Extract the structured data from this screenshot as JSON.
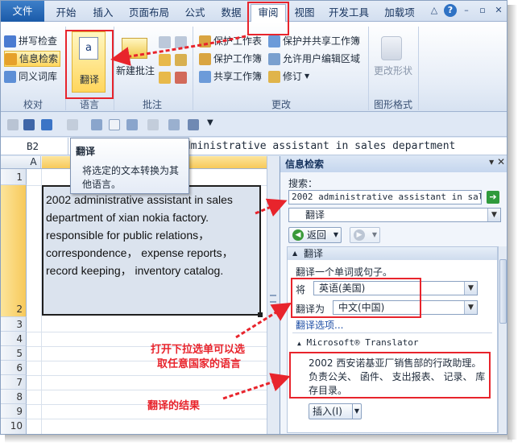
{
  "tabs": [
    "文件",
    "开始",
    "插入",
    "页面布局",
    "公式",
    "数据",
    "审阅",
    "视图",
    "开发工具",
    "加载项"
  ],
  "active_tab": "审阅",
  "window_buttons": [
    "△",
    "?",
    "–",
    "▫",
    "✕"
  ],
  "ribbon": {
    "proofing": {
      "spell": "拼写检查",
      "research": "信息检索",
      "thesaurus": "同义词库",
      "label": "校对"
    },
    "language": {
      "translate": "翻译",
      "label": "语言"
    },
    "comments": {
      "new_comment": "新建批注",
      "label": "批注"
    },
    "changes": {
      "protect_sheet": "保护工作表",
      "protect_workbook": "保护工作簿",
      "share_workbook": "共享工作簿",
      "protect_share": "保护并共享工作簿",
      "allow_edit": "允许用户编辑区域",
      "track": "修订",
      "label": "更改"
    },
    "ink": {
      "change_shape": "更改形状",
      "label": "图形格式"
    }
  },
  "formula_bar": {
    "name_box": "B2",
    "content": "administrative assistant in sales department"
  },
  "tooltip": {
    "title": "翻译",
    "body": "将选定的文本转换为其他语言。"
  },
  "sheet": {
    "col_a": "A",
    "rows": [
      "1",
      "2",
      "3",
      "4",
      "5",
      "6",
      "7",
      "8",
      "9",
      "10"
    ],
    "cell_b2_lines": [
      "2002 administrative assistant in sales",
      "department of xian nokia factory.",
      "responsible for public relations，",
      "correspondence，  expense reports，",
      "record keeping，  inventory catalog."
    ]
  },
  "pane": {
    "title": "信息检索",
    "search_label": "搜索：",
    "search_value": "2002 administrative assistant in sales department of",
    "service": "翻译",
    "back": "返回",
    "results_header": "翻译",
    "instruction": "翻译一个单词或句子。",
    "from_label": "将",
    "from_value": "英语(美国)",
    "to_label": "翻译为",
    "to_value": "中文(中国)",
    "options_link": "翻译选项...",
    "provider": "Microsoft® Translator",
    "result_lines": [
      "2002 西安诺基亚厂销售部的行政助理。",
      "负责公关、 函件、 支出报表、 记录、 库",
      "存目录。"
    ],
    "insert": "插入(I)"
  },
  "annotations": {
    "dropdown_note": [
      "打开下拉选单可以选",
      "取任意国家的语言"
    ],
    "result_note": "翻译的结果"
  },
  "colors": {
    "annotation": "#e8242c",
    "file_tab": "#1a5aa8",
    "highlight": "#ffd65c"
  }
}
